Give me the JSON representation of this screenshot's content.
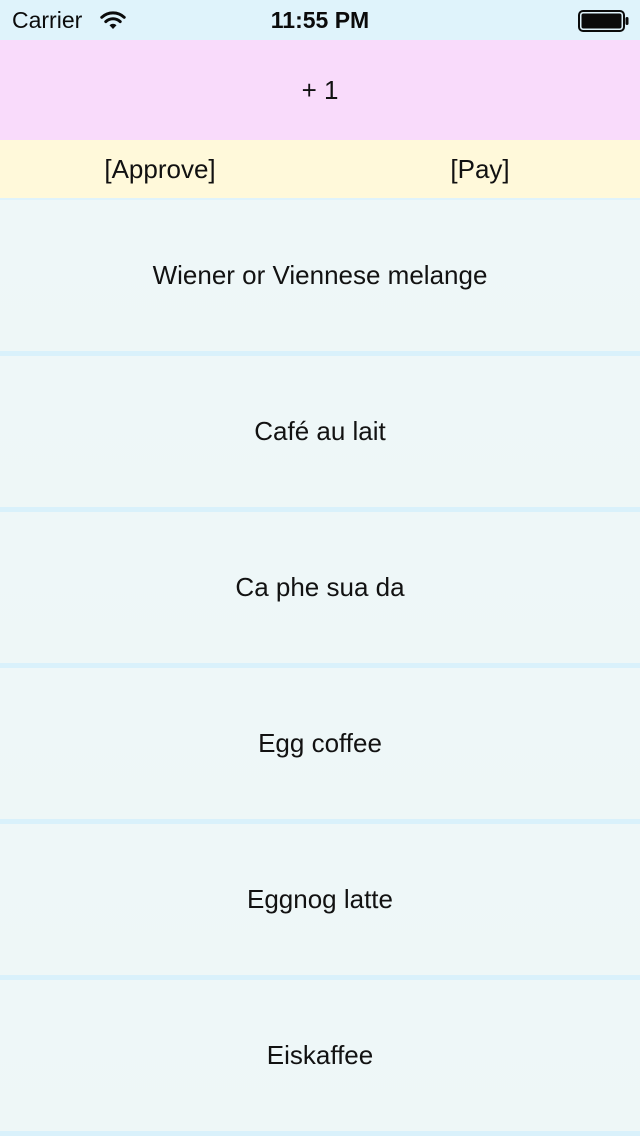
{
  "status_bar": {
    "carrier": "Carrier",
    "time": "11:55 PM",
    "wifi_icon": "wifi-icon",
    "battery_icon": "battery-full-icon"
  },
  "counter": {
    "label": "+ 1"
  },
  "actions": {
    "approve_label": "[Approve]",
    "pay_label": "[Pay]"
  },
  "list": {
    "items": [
      {
        "label": "Wiener or Viennese melange"
      },
      {
        "label": "Café au lait"
      },
      {
        "label": "Ca phe sua da"
      },
      {
        "label": "Egg coffee"
      },
      {
        "label": "Eggnog latte"
      },
      {
        "label": "Eiskaffee"
      }
    ]
  },
  "colors": {
    "status_bar_bg": "#dff3fb",
    "counter_bg": "#f9dbfb",
    "action_bar_bg": "#fff9da",
    "list_item_bg": "#eef7f8",
    "separator": "#d9f1fb"
  }
}
